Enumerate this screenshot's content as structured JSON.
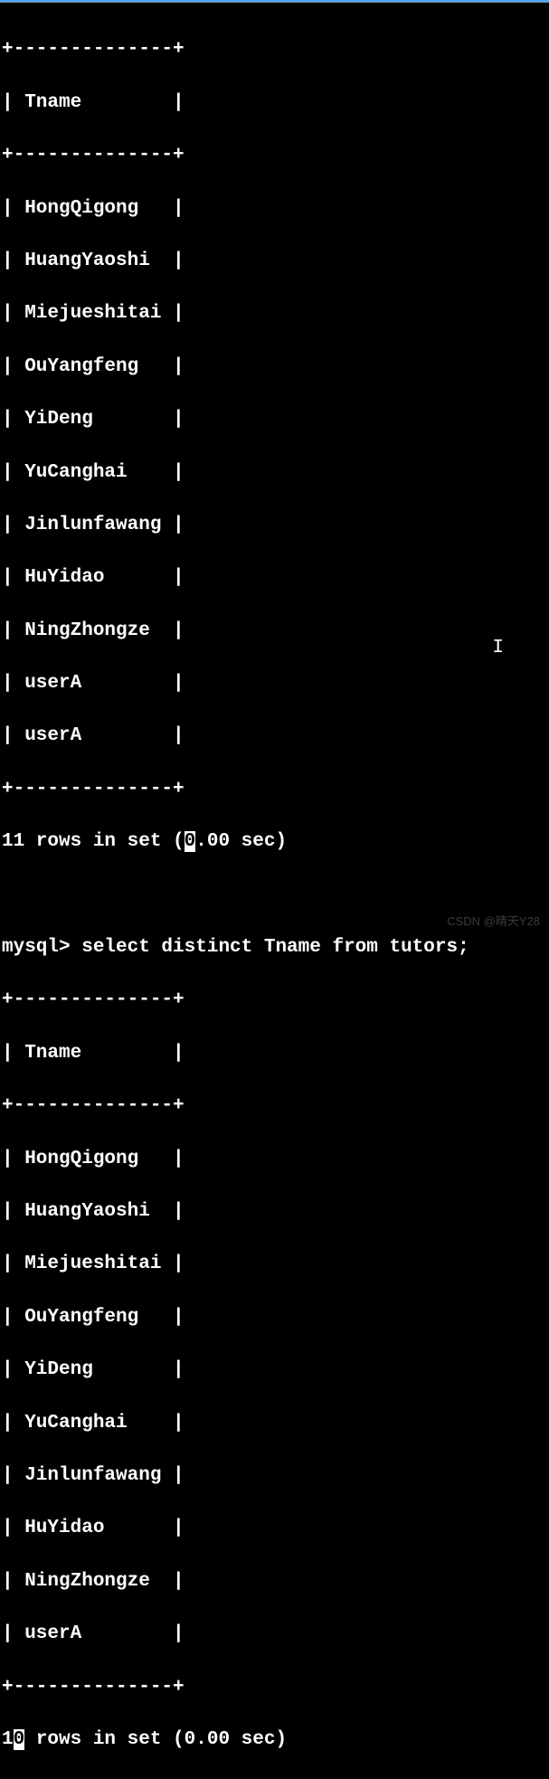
{
  "table1": {
    "border": "+--------------+",
    "header": "| Tname        |",
    "rows": [
      "| HongQigong   |",
      "| HuangYaoshi  |",
      "| Miejueshitai |",
      "| OuYangfeng   |",
      "| YiDeng       |",
      "| YuCanghai    |",
      "| Jinlunfawang |",
      "| HuYidao      |",
      "| NingZhongze  |",
      "| userA        |",
      "| userA        |"
    ],
    "summary_prefix": "11 rows in set (",
    "summary_selected": "0",
    "summary_suffix": ".00 sec)"
  },
  "command": {
    "prompt": "mysql> ",
    "query": "select distinct Tname from tutors;"
  },
  "table2": {
    "border": "+--------------+",
    "header": "| Tname        |",
    "rows": [
      "| HongQigong   |",
      "| HuangYaoshi  |",
      "| Miejueshitai |",
      "| OuYangfeng   |",
      "| YiDeng       |",
      "| YuCanghai    |",
      "| Jinlunfawang |",
      "| HuYidao      |",
      "| NingZhongze  |",
      "| userA        |"
    ],
    "summary_prefix": "1",
    "summary_selected": "0",
    "summary_suffix": " rows in set (0.00 sec)"
  },
  "cursor_char": "I",
  "watermark": "CSDN @晴天Y28"
}
